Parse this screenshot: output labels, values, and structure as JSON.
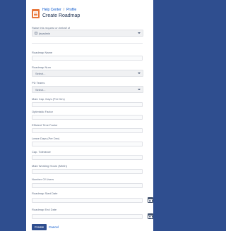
{
  "breadcrumbs": [
    "Help Center",
    "Profile"
  ],
  "page_title": "Create Roadmap",
  "raise_on_behalf": {
    "label": "Raise this request on behalf of",
    "value": "jiraadmin"
  },
  "fields": [
    {
      "label": "Roadmap Name"
    },
    {
      "label": "Roadmap Num",
      "type": "select",
      "value": "Select..."
    },
    {
      "label": "PD Teams",
      "type": "select",
      "value": "Select..."
    },
    {
      "label": "Main Cap. Days (Per Dev)"
    },
    {
      "label": "Optimistic Factor"
    },
    {
      "label": "Efficient Time Factor"
    },
    {
      "label": "Leave Days (Per Dev)"
    },
    {
      "label": "Cap. Tolerance"
    },
    {
      "label": "Main Working Hours (Mhhh)"
    },
    {
      "label": "Number Of Users"
    },
    {
      "label": "Roadmap Start Date",
      "type": "date"
    },
    {
      "label": "Roadmap End Date",
      "type": "date"
    }
  ],
  "buttons": {
    "create": "Create",
    "cancel": "Cancel"
  }
}
